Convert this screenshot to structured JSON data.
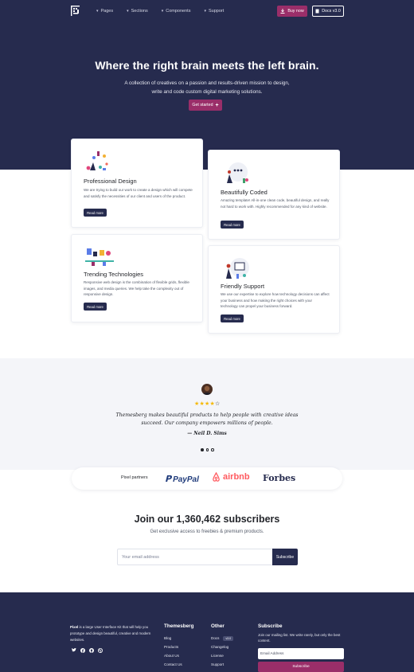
{
  "nav": {
    "items": [
      {
        "label": "Pages"
      },
      {
        "label": "Sections"
      },
      {
        "label": "Components"
      },
      {
        "label": "Support"
      }
    ],
    "buy_label": "Buy now",
    "docs_label": "Docs v3.0"
  },
  "hero": {
    "title_pre": "Where the ",
    "title_b1": "right",
    "title_mid": " brain meets the ",
    "title_b2": "left",
    "title_post": " brain.",
    "subtitle": "A collection of creatives on a passion and results-driven mission to design, write and code custom digital marketing solutions.",
    "cta_label": "Get started"
  },
  "features": [
    {
      "title": "Professional Design",
      "text": "We are trying to build our work to create a design which will compete and satisfy the necessities of our client and users of the product.",
      "button": "Read more"
    },
    {
      "title": "Beautifully Coded",
      "text": "Amazing template! All-in-one clean code, beautiful design, and really not hard to work with. Highly recommended for any kind of website.",
      "button": "Read more"
    },
    {
      "title": "Trending Technologies",
      "text": "Responsive web design is the combination of flexible grids, flexible images, and media queries. We help take the complexity out of responsive design.",
      "button": "Read more"
    },
    {
      "title": "Friendly Support",
      "text": "We use our expertise to explore how technology decisions can affect your business and how making the right choices with your technology can propel your business forward.",
      "button": "Read more"
    }
  ],
  "testimonial": {
    "rating": 4,
    "max_rating": 5,
    "quote": "Themesberg makes beautiful products to help people with creative ideas succeed. Our company empowers millions of people.",
    "author": "— Neil D. Sims"
  },
  "partners": {
    "label": "Pixel partners",
    "logos": [
      "PayPal",
      "airbnb",
      "Forbes"
    ]
  },
  "subscribe": {
    "title_pre": "Join our ",
    "count": "1,360,462",
    "title_post": " subscribers",
    "subtitle": "Get exclusive access to freebies & premium products.",
    "placeholder": "Your email address",
    "button": "Subscribe"
  },
  "footer": {
    "brand": "Pixel",
    "about": " is a large User Interface Kit that will help you prototype and design beautiful, creative and modern websites.",
    "col1": {
      "title": "Themesberg",
      "links": [
        "Blog",
        "Products",
        "About Us",
        "Contact Us"
      ]
    },
    "col2": {
      "title": "Other",
      "links": [
        "Docs",
        "Changelog",
        "License",
        "Support"
      ],
      "badge": "v3.0"
    },
    "newsletter": {
      "title": "Subscribe",
      "text": "Join our mailing list. We write rarely, but only the best content.",
      "placeholder": "Email Address",
      "button": "Subscribe"
    }
  },
  "colors": {
    "navy": "#262b4e",
    "accent": "#9a2e69",
    "star": "#f5b800"
  }
}
